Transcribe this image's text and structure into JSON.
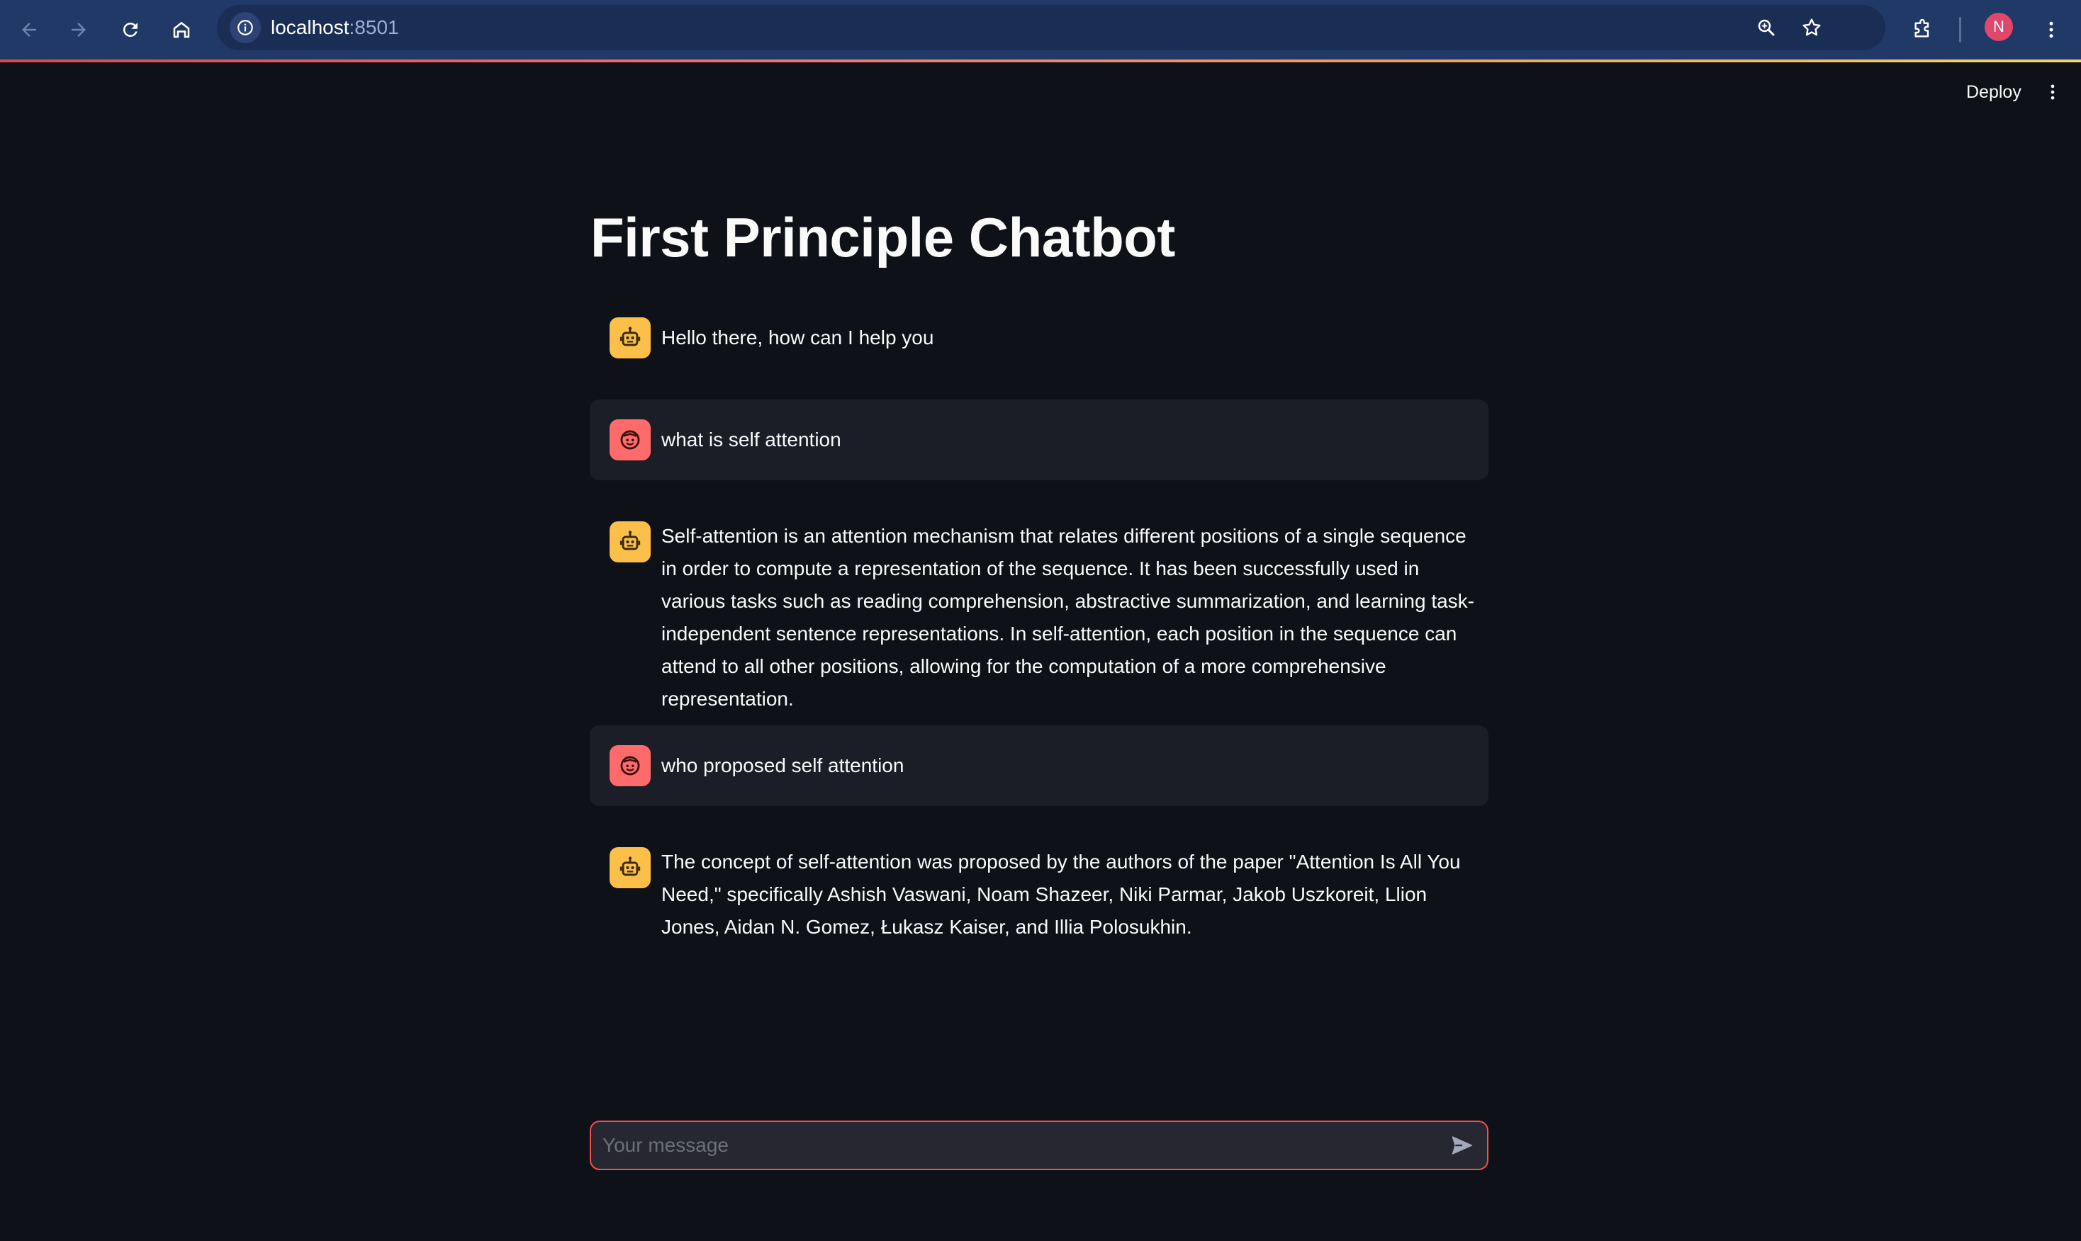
{
  "browser": {
    "url_host": "localhost",
    "url_port": ":8501",
    "profile_initial": "N"
  },
  "header": {
    "deploy_label": "Deploy"
  },
  "page": {
    "title": "First Principle Chatbot"
  },
  "messages": [
    {
      "role": "assistant",
      "avatar_icon": "robot-icon",
      "text": "Hello there, how can I help you"
    },
    {
      "role": "user",
      "avatar_icon": "face-icon",
      "text": "what is self attention"
    },
    {
      "role": "assistant",
      "avatar_icon": "robot-icon",
      "text": "Self-attention is an attention mechanism that relates different positions of a single sequence in order to compute a representation of the sequence. It has been successfully used in various tasks such as reading comprehension, abstractive summarization, and learning task-independent sentence representations. In self-attention, each position in the sequence can attend to all other positions, allowing for the computation of a more comprehensive representation."
    },
    {
      "role": "user",
      "avatar_icon": "face-icon",
      "text": "who proposed self attention"
    },
    {
      "role": "assistant",
      "avatar_icon": "robot-icon",
      "text": "The concept of self-attention was proposed by the authors of the paper \"Attention Is All You Need,\" specifically Ashish Vaswani, Noam Shazeer, Niki Parmar, Jakob Uszkoreit, Llion Jones, Aidan N. Gomez, Łukasz Kaiser, and Illia Polosukhin."
    }
  ],
  "chat_input": {
    "placeholder": "Your message",
    "value": ""
  },
  "colors": {
    "browser_bar": "#213966",
    "app_background": "#0e1117",
    "user_message_background": "#1b1e26",
    "assistant_avatar": "#fbbf4a",
    "user_avatar": "#ff6b6b",
    "input_border": "#ff4b4b",
    "profile_avatar": "#e1476b"
  }
}
